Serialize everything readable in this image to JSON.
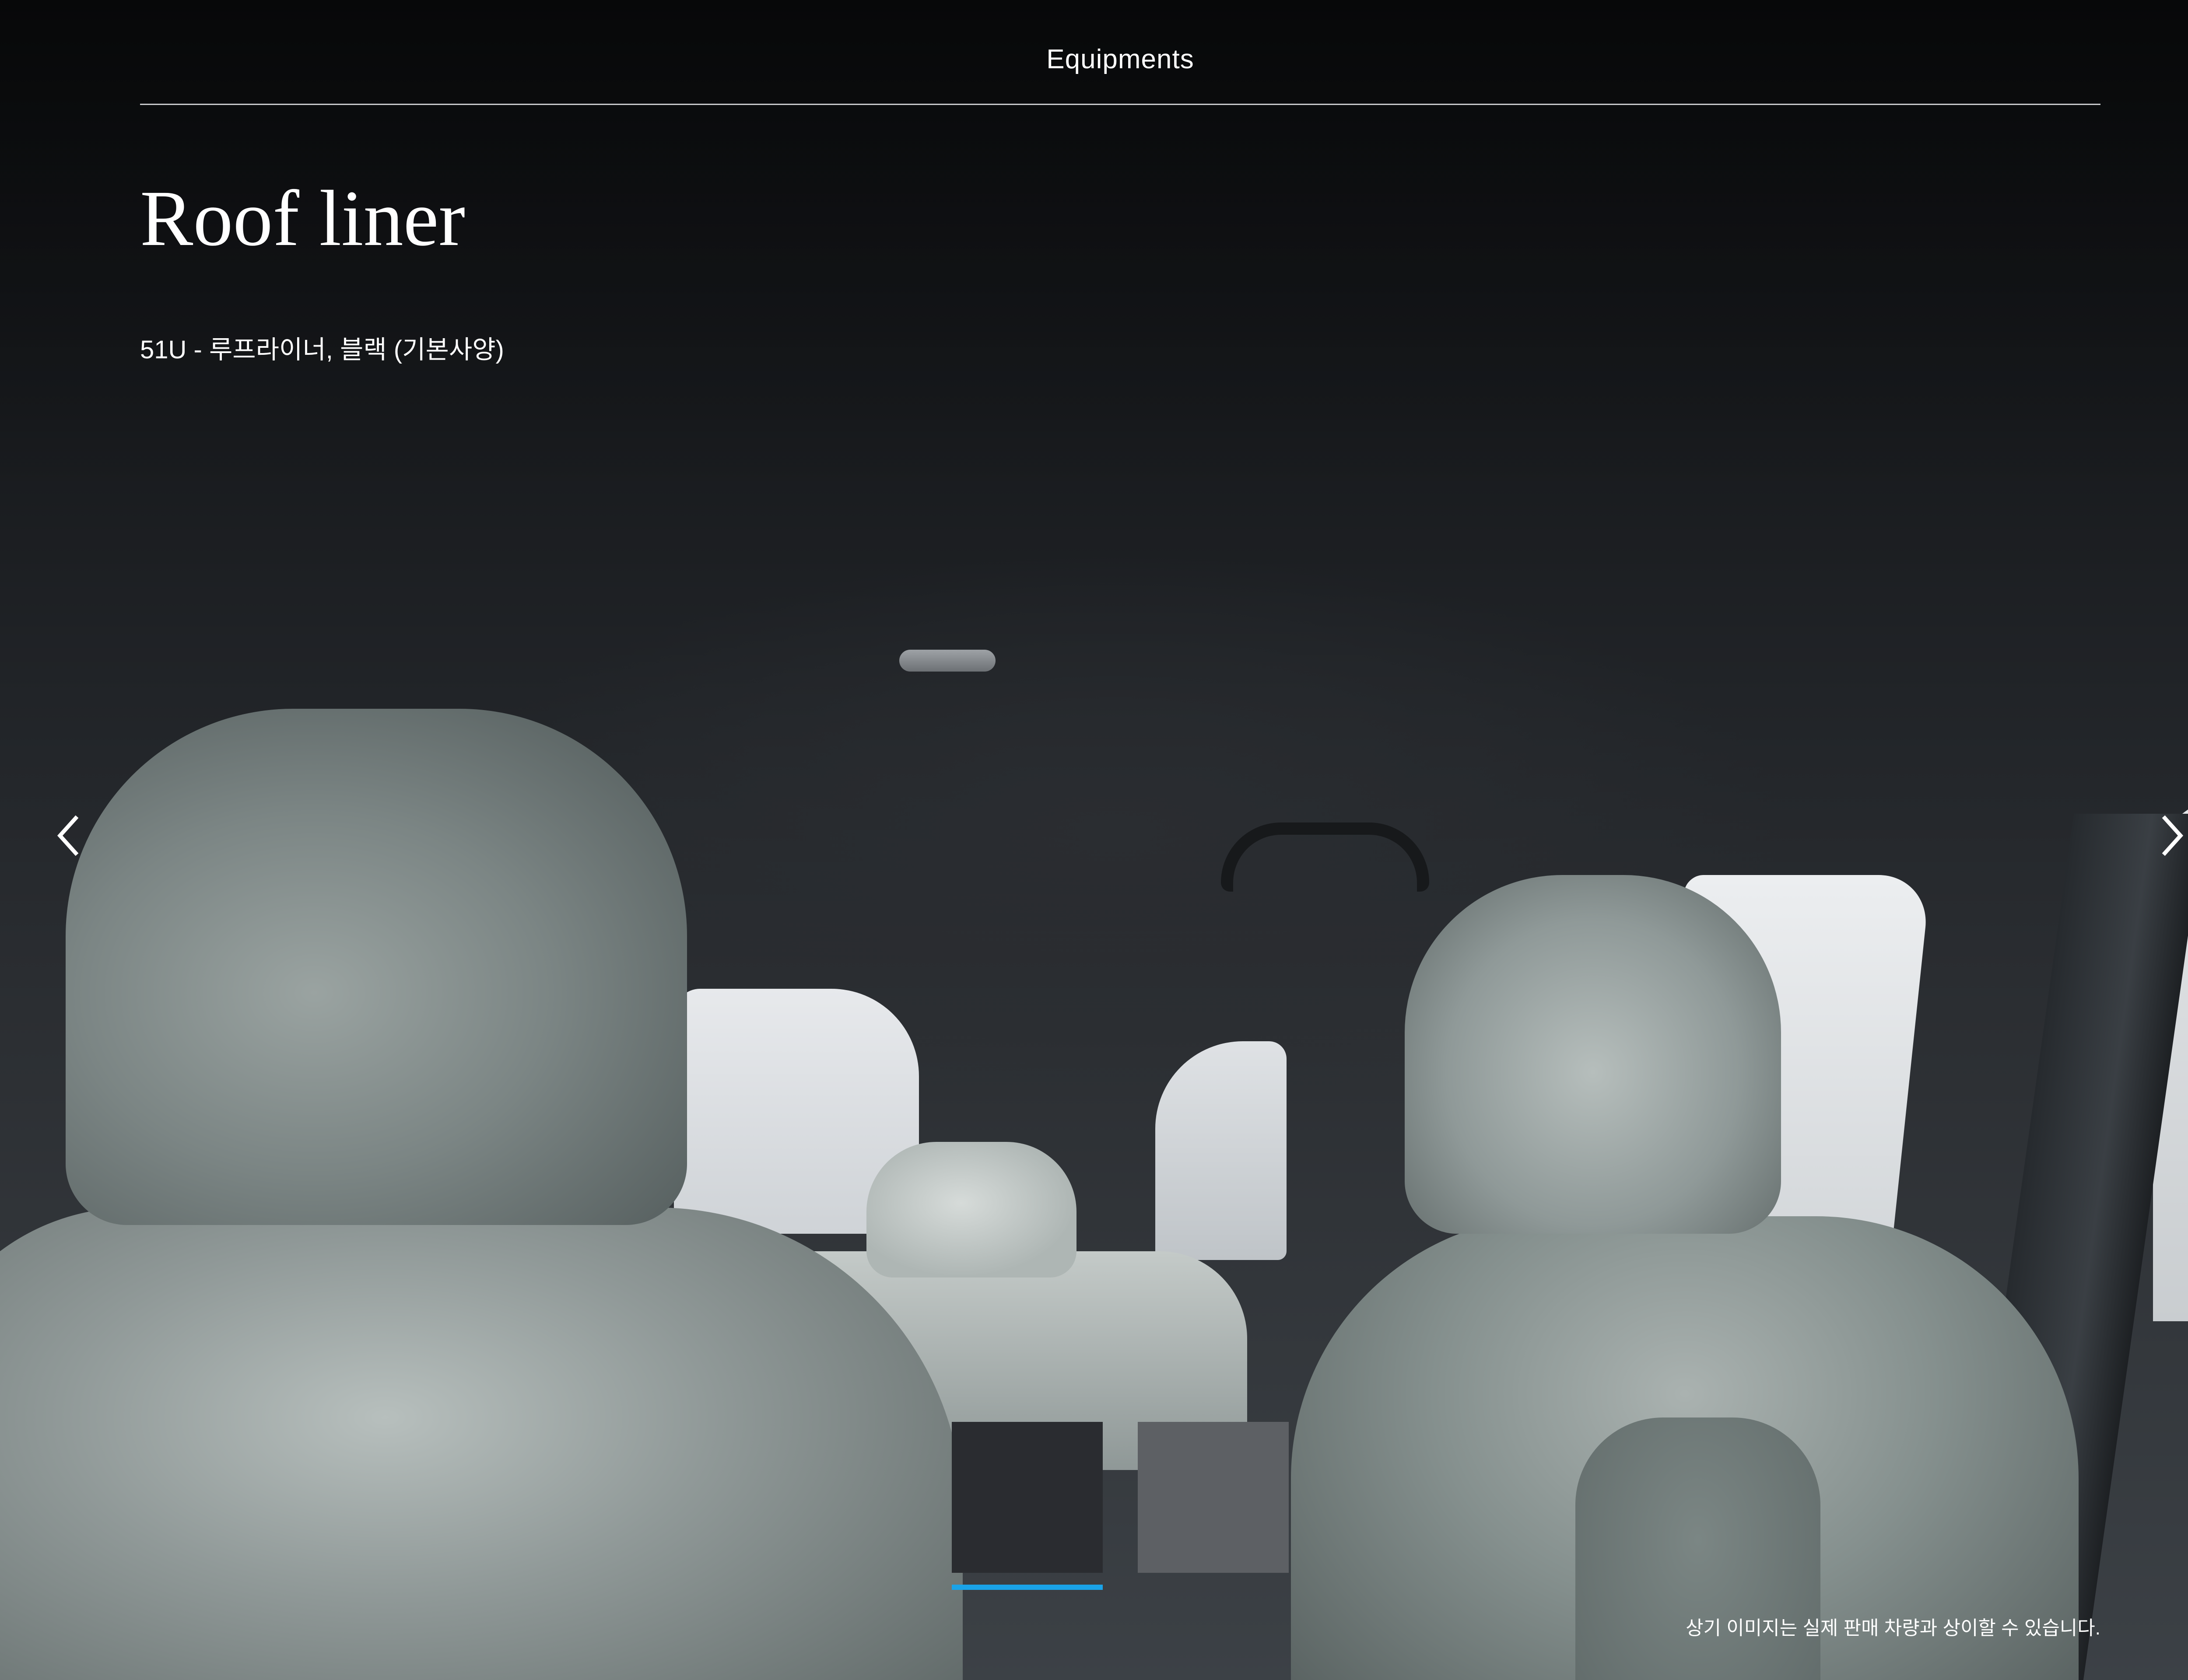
{
  "header": {
    "title": "Equipments"
  },
  "main": {
    "title": "Roof liner",
    "option": "51U - 루프라이너, 블랙 (기본사양)",
    "disclaimer": "상기 이미지는 실제 판매 차량과 상이할 수 있습니다."
  },
  "navigation": {
    "prev_icon": "chevron-left-icon",
    "next_icon": "chevron-right-icon"
  },
  "swatches": [
    {
      "name": "black",
      "color": "#2a2c30",
      "selected": true
    },
    {
      "name": "grey",
      "color": "#5d6064",
      "selected": false
    }
  ],
  "colors": {
    "accent": "#1aa3e8",
    "text": "#ffffff",
    "rule": "#c9cbcd"
  }
}
